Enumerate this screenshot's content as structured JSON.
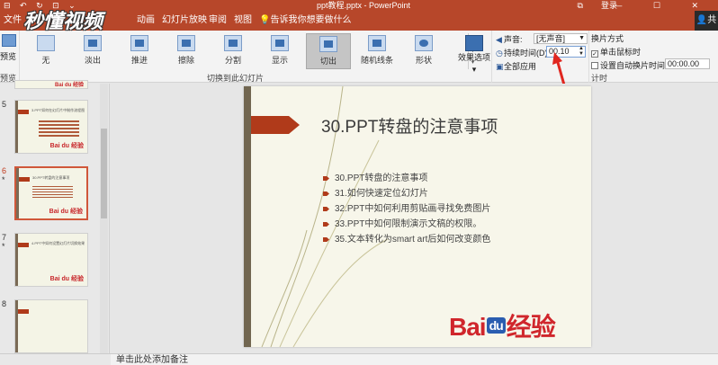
{
  "titlebar": {
    "quick_access": "⊟ ↶ ↻ ⊡ ⌄",
    "doc_title": "ppt教程.pptx - PowerPoint",
    "login": "登录",
    "window_buttons": "⧉ — ☐ ✕"
  },
  "watermark": "秒懂视频",
  "tabs": {
    "file": "文件",
    "animation": "动画",
    "slideshow": "幻灯片放映",
    "review": "审阅",
    "view": "视图",
    "tell_me": "告诉我你想要做什么",
    "share": "共享"
  },
  "ribbon": {
    "preview": {
      "label": "预览",
      "group": "预览"
    },
    "transitions": [
      {
        "label": "无"
      },
      {
        "label": "淡出"
      },
      {
        "label": "推进"
      },
      {
        "label": "擦除"
      },
      {
        "label": "分割"
      },
      {
        "label": "显示"
      },
      {
        "label": "切出"
      },
      {
        "label": "随机线条"
      },
      {
        "label": "形状"
      }
    ],
    "transitions_group": "切换到此幻灯片",
    "effect_options": "效果选项",
    "timing": {
      "sound_label": "声音:",
      "sound_value": "[无声音]",
      "duration_label": "持续时间(D):",
      "duration_value": "00.10",
      "apply_all": "全部应用",
      "group": "计时"
    },
    "advance": {
      "title": "换片方式",
      "on_click": "单击鼠标时",
      "after_label": "设置自动换片时间:",
      "after_value": "00:00.00"
    }
  },
  "slides_panel": {
    "slides": [
      {
        "number": "5",
        "title": "3.PPT如何在幻灯片中制作流程图"
      },
      {
        "number": "6",
        "marker": "*",
        "title": "30.PPT转盘的注意事项"
      },
      {
        "number": "7",
        "marker": "*",
        "title": "4.PPT中如何设置幻灯片切换效果"
      },
      {
        "number": "8",
        "title": ""
      }
    ],
    "logo": "Bai du 经验"
  },
  "slide": {
    "title": "30.PPT转盘的注意事项",
    "bullets": [
      "30.PPT转盘的注意事项",
      "31.如何快速定位幻灯片",
      "32.PPT中如何利用剪贴画寻找免费图片",
      "33.PPT中如何限制演示文稿的权限。",
      "35.文本转化为smart art后如何改变颜色"
    ],
    "logo_bai": "Bai",
    "logo_du": "du",
    "logo_jy": "经验"
  },
  "notes": "单击此处添加备注",
  "colors": {
    "accent": "#b7472a",
    "bullet": "#b03a1a",
    "slide_bg": "#f7f6ea",
    "logo_red": "#d0262c",
    "logo_blue": "#2a5db0"
  }
}
